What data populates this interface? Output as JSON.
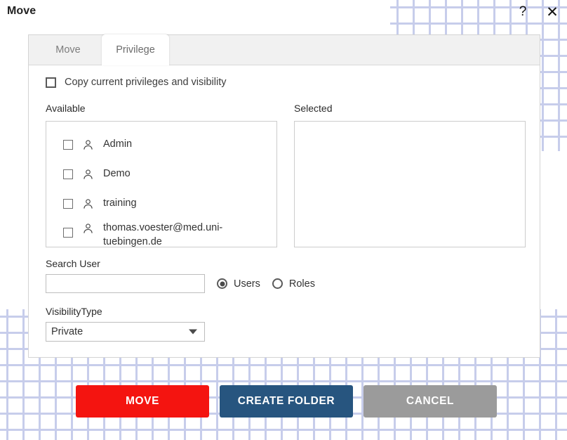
{
  "window": {
    "title": "Move",
    "help_icon": "question-mark-icon",
    "close_icon": "close-x-icon",
    "help_glyph": "?",
    "close_glyph": "✕"
  },
  "tabs": [
    {
      "label": "Move",
      "active": false
    },
    {
      "label": "Privilege",
      "active": true
    }
  ],
  "form": {
    "copy_privileges_label": "Copy current privileges and visibility",
    "copy_privileges_checked": false,
    "available_title": "Available",
    "selected_title": "Selected",
    "available_items": [
      {
        "label": "Admin",
        "checked": false
      },
      {
        "label": "Demo",
        "checked": false
      },
      {
        "label": "training",
        "checked": false
      },
      {
        "label": "thomas.voester@med.uni-tuebingen.de",
        "checked": false
      }
    ],
    "selected_items": [],
    "search_label": "Search User",
    "search_value": "",
    "search_placeholder": "",
    "radio_users_label": "Users",
    "radio_roles_label": "Roles",
    "radio_selected": "Users",
    "visibility_label": "VisibilityType",
    "visibility_value": "Private"
  },
  "actions": {
    "move_label": "MOVE",
    "create_folder_label": "CREATE FOLDER",
    "cancel_label": "CANCEL"
  },
  "colors": {
    "move_red": "#f41410",
    "create_blue": "#27557f",
    "cancel_gray": "#9b9b9b",
    "pattern_blue": "#9aa5dc"
  }
}
